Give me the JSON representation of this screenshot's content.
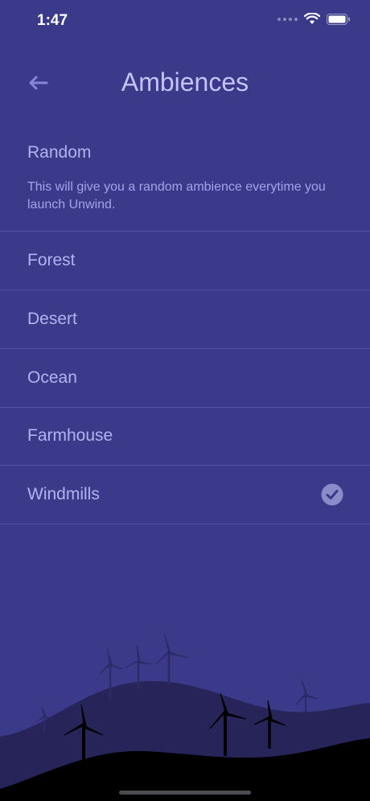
{
  "status": {
    "time": "1:47"
  },
  "header": {
    "title": "Ambiences"
  },
  "random": {
    "title": "Random",
    "description": "This will give you a random ambience everytime you launch Unwind."
  },
  "ambiences": [
    {
      "label": "Forest",
      "selected": false
    },
    {
      "label": "Desert",
      "selected": false
    },
    {
      "label": "Ocean",
      "selected": false
    },
    {
      "label": "Farmhouse",
      "selected": false
    },
    {
      "label": "Windmills",
      "selected": true
    }
  ],
  "colors": {
    "background": "#3b3a8a",
    "text": "#b3b2f0",
    "divider": "#5351a3",
    "hills_back": "#272459",
    "hills_front": "#000000"
  },
  "icons": {
    "back": "arrow-left-icon",
    "selected": "check-circle-icon",
    "wifi": "wifi-icon",
    "battery": "battery-icon"
  }
}
